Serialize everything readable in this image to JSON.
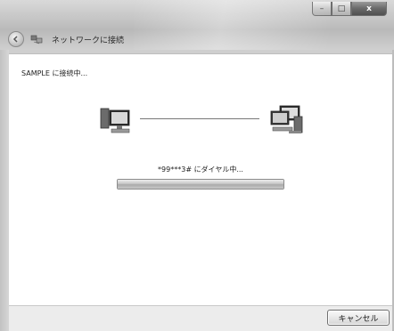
{
  "window": {
    "title": "ネットワークに接続",
    "minimize_label": "–",
    "maximize_label": "□",
    "close_label": "x"
  },
  "main": {
    "connecting_text": "SAMPLE に接続中...",
    "dialing_text": "*99***3# にダイヤル中...",
    "progress_fraction": 1.0
  },
  "footer": {
    "cancel_label": "キャンセル"
  },
  "icons": {
    "back": "back-arrow-icon",
    "network": "network-icon",
    "local_computer": "computer-icon",
    "remote_computer": "network-computers-icon"
  }
}
